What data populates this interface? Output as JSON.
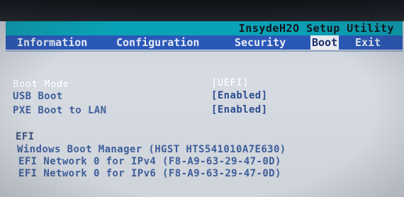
{
  "title": "InsydeH2O Setup Utility",
  "menu": {
    "tabs": [
      {
        "label": "Information"
      },
      {
        "label": "Configuration"
      },
      {
        "label": "Security"
      },
      {
        "label": "Boot"
      },
      {
        "label": "Exit"
      }
    ],
    "active": "Boot"
  },
  "settings": [
    {
      "label": "Boot Mode",
      "value": "[UEFI]"
    },
    {
      "label": "USB Boot",
      "value": "[Enabled]"
    },
    {
      "label": "PXE Boot to LAN",
      "value": "[Enabled]"
    }
  ],
  "efi": {
    "header": "EFI",
    "items": [
      "Windows Boot Manager (HGST HTS541010A7E630)",
      "EFI Network 0 for IPv4 (F8-A9-63-29-47-0D)",
      "EFI Network 0 for IPv6 (F8-A9-63-29-47-0D)"
    ]
  },
  "colors": {
    "title_bar": "#0aa2b6",
    "menu_bar": "#2a58b8",
    "screen_bg": "#d0d4db",
    "selected_text": "#ffffff"
  }
}
